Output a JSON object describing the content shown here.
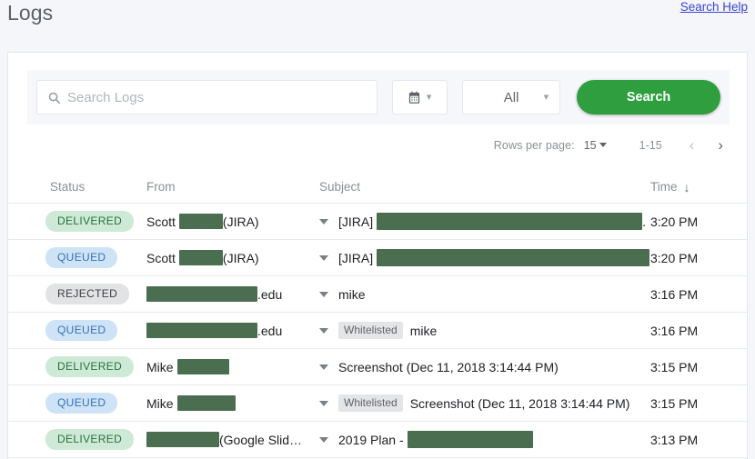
{
  "header": {
    "title": "Logs",
    "help_link": "Search Help"
  },
  "search": {
    "placeholder": "Search Logs",
    "value": "",
    "search_icon": "search-icon",
    "date_filter": {
      "icon": "calendar-icon",
      "value": ""
    },
    "type_filter": {
      "value": "All"
    },
    "submit_label": "Search",
    "accent_color": "#2e9e3e"
  },
  "pagination": {
    "rows_per_page_label": "Rows per page:",
    "rows_per_page_value": "15",
    "range": "1-15",
    "prev_icon": "chevron-left-icon",
    "next_icon": "chevron-right-icon"
  },
  "table": {
    "columns": [
      "Status",
      "From",
      "Subject",
      "Time"
    ],
    "sort_column": "Time",
    "sort_direction": "desc",
    "sort_icon": "arrow-down-icon",
    "rows": [
      {
        "status": "DELIVERED",
        "status_kind": "delivered",
        "from_prefix": "Scott",
        "from_redact_width": 48,
        "from_suffix": "(JIRA)",
        "whitelisted": "",
        "subject_prefix": "[JIRA]",
        "subject_redact_width": 292,
        "subject_suffix": ".",
        "time": "3:20 PM"
      },
      {
        "status": "QUEUED",
        "status_kind": "queued",
        "from_prefix": "Scott",
        "from_redact_width": 48,
        "from_suffix": "(JIRA)",
        "whitelisted": "",
        "subject_prefix": "[JIRA]",
        "subject_redact_width": 300,
        "subject_suffix": "",
        "time": "3:20 PM"
      },
      {
        "status": "REJECTED",
        "status_kind": "rejected",
        "from_prefix": "",
        "from_redact_width": 122,
        "from_suffix": ".edu",
        "whitelisted": "",
        "subject_prefix": "mike",
        "subject_redact_width": 0,
        "subject_suffix": "",
        "time": "3:16 PM"
      },
      {
        "status": "QUEUED",
        "status_kind": "queued",
        "from_prefix": "",
        "from_redact_width": 122,
        "from_suffix": ".edu",
        "whitelisted": "Whitelisted",
        "subject_prefix": "mike",
        "subject_redact_width": 0,
        "subject_suffix": "",
        "time": "3:16 PM"
      },
      {
        "status": "DELIVERED",
        "status_kind": "delivered",
        "from_prefix": "Mike",
        "from_redact_width": 57,
        "from_suffix": "",
        "whitelisted": "",
        "subject_prefix": "Screenshot (Dec 11, 2018 3:14:44 PM)",
        "subject_redact_width": 0,
        "subject_suffix": "",
        "time": "3:15 PM"
      },
      {
        "status": "QUEUED",
        "status_kind": "queued",
        "from_prefix": "Mike",
        "from_redact_width": 64,
        "from_suffix": "",
        "whitelisted": "Whitelisted",
        "subject_prefix": "Screenshot (Dec 11, 2018 3:14:44 PM)",
        "subject_redact_width": 0,
        "subject_suffix": "",
        "time": "3:15 PM"
      },
      {
        "status": "DELIVERED",
        "status_kind": "delivered",
        "from_prefix": "",
        "from_redact_width": 80,
        "from_suffix": "(Google Slid…",
        "whitelisted": "",
        "subject_prefix": "2019 Plan -",
        "subject_redact_width": 138,
        "subject_suffix": "",
        "time": "3:13 PM"
      }
    ]
  }
}
